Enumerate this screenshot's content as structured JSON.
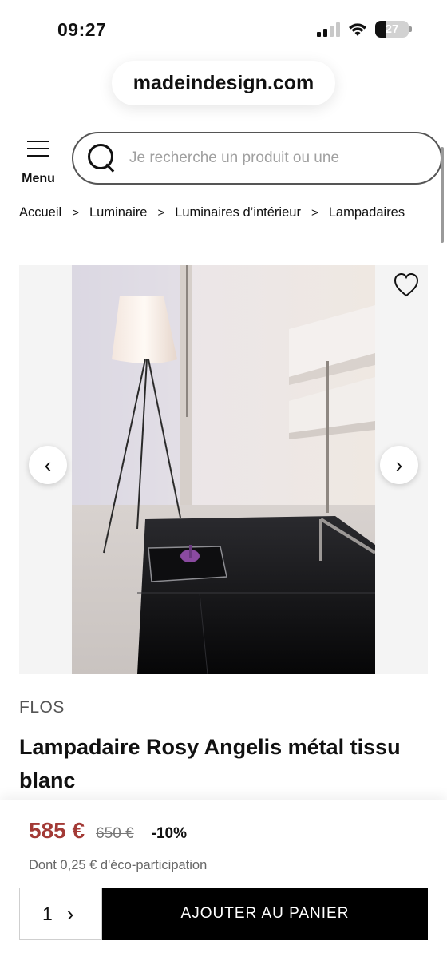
{
  "status_bar": {
    "time": "09:27",
    "battery": "27"
  },
  "browser": {
    "domain": "madeindesign.com"
  },
  "header": {
    "menu_label": "Menu",
    "search_placeholder": "Je recherche un produit ou une"
  },
  "breadcrumb": [
    "Accueil",
    "Luminaire",
    "Luminaires d’intérieur",
    "Lampadaires"
  ],
  "breadcrumb_separator": ">",
  "gallery": {
    "prev_icon": "‹",
    "next_icon": "›"
  },
  "product": {
    "brand": "FLOS",
    "title": "Lampadaire Rosy Angelis métal tissu blanc",
    "price": "585 €",
    "old_price": "650 €",
    "discount": "-10%",
    "eco_fee": "Dont 0,25 € d'éco-participation"
  },
  "cart": {
    "quantity": "1",
    "add_label": "AJOUTER AU PANIER"
  },
  "colors": {
    "price": "#a33a36",
    "button": "#000000"
  }
}
